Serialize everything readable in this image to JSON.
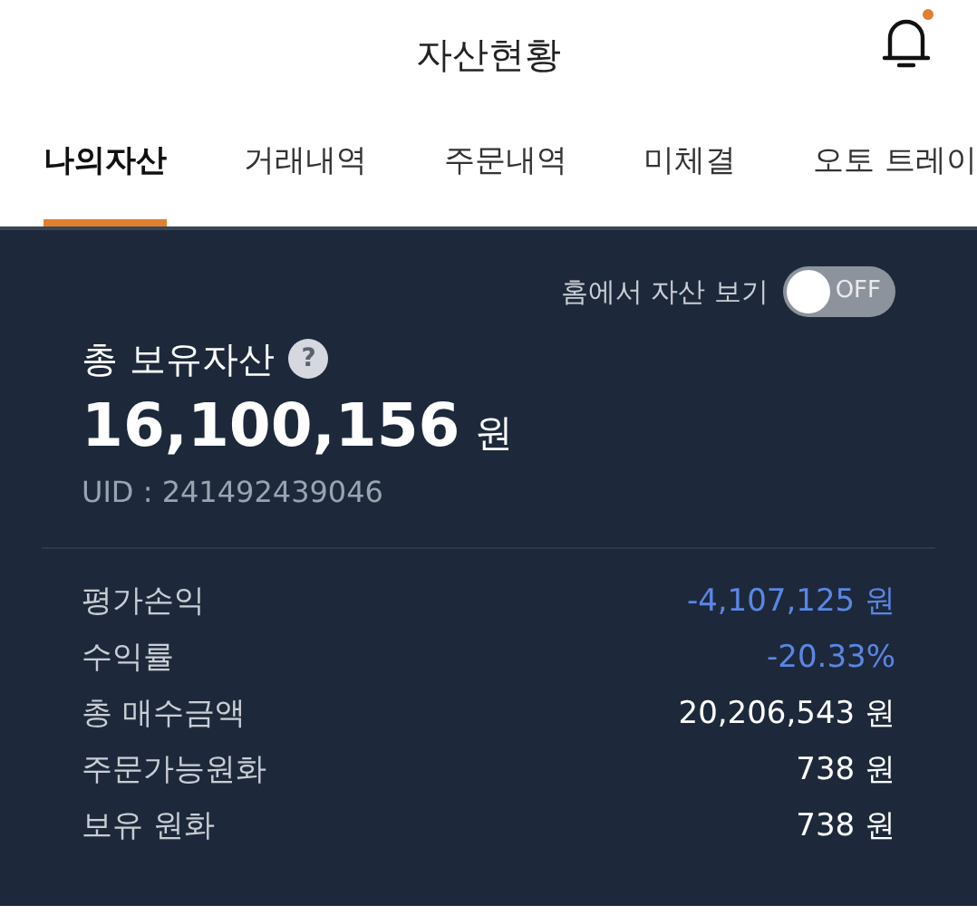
{
  "header": {
    "title": "자산현황",
    "has_notification": true
  },
  "tabs": [
    {
      "label": "나의자산",
      "selected": true
    },
    {
      "label": "거래내역",
      "selected": false
    },
    {
      "label": "주문내역",
      "selected": false
    },
    {
      "label": "미체결",
      "selected": false
    },
    {
      "label": "오토 트레이",
      "selected": false
    }
  ],
  "summary": {
    "home_toggle": {
      "label": "홈에서 자산 보기",
      "on": false,
      "state_text": "OFF"
    },
    "title": "총 보유자산",
    "help_icon": "?",
    "amount": "16,100,156",
    "unit": "원",
    "uid": "UID : 241492439046"
  },
  "details": [
    {
      "label": "평가손익",
      "value": "-4,107,125 원",
      "kind": "negative"
    },
    {
      "label": "수익률",
      "value": "-20.33%",
      "kind": "negative"
    },
    {
      "label": "총 매수금액",
      "value": "20,206,543 원",
      "kind": "neutral"
    },
    {
      "label": "주문가능원화",
      "value": "738 원",
      "kind": "neutral"
    },
    {
      "label": "보유 원화",
      "value": "738 원",
      "kind": "neutral"
    }
  ]
}
